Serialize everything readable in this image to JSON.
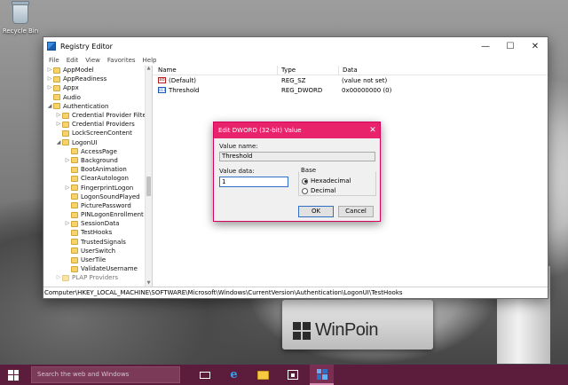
{
  "desktop": {
    "recycle_bin_label": "Recycle Bin",
    "brand_text": "WinPoin"
  },
  "window": {
    "title": "Registry Editor",
    "controls": {
      "minimize": "—",
      "maximize": "☐",
      "close": "✕"
    },
    "menu": [
      "File",
      "Edit",
      "View",
      "Favorites",
      "Help"
    ],
    "tree": [
      {
        "label": "AppModel",
        "level": 0,
        "expander": "▷"
      },
      {
        "label": "AppReadiness",
        "level": 0,
        "expander": "▷"
      },
      {
        "label": "Appx",
        "level": 0,
        "expander": "▷"
      },
      {
        "label": "Audio",
        "level": 0,
        "expander": ""
      },
      {
        "label": "Authentication",
        "level": 0,
        "expander": "◢"
      },
      {
        "label": "Credential Provider Filters",
        "level": 1,
        "expander": "▷"
      },
      {
        "label": "Credential Providers",
        "level": 1,
        "expander": "▷"
      },
      {
        "label": "LockScreenContent",
        "level": 1,
        "expander": ""
      },
      {
        "label": "LogonUI",
        "level": 1,
        "expander": "◢"
      },
      {
        "label": "AccessPage",
        "level": 2,
        "expander": ""
      },
      {
        "label": "Background",
        "level": 2,
        "expander": "▷"
      },
      {
        "label": "BootAnimation",
        "level": 2,
        "expander": ""
      },
      {
        "label": "ClearAutologon",
        "level": 2,
        "expander": ""
      },
      {
        "label": "FingerprintLogon",
        "level": 2,
        "expander": "▷"
      },
      {
        "label": "LogonSoundPlayed",
        "level": 2,
        "expander": ""
      },
      {
        "label": "PicturePassword",
        "level": 2,
        "expander": ""
      },
      {
        "label": "PINLogonEnrollment",
        "level": 2,
        "expander": ""
      },
      {
        "label": "SessionData",
        "level": 2,
        "expander": "▷"
      },
      {
        "label": "TestHooks",
        "level": 2,
        "expander": ""
      },
      {
        "label": "TrustedSignals",
        "level": 2,
        "expander": ""
      },
      {
        "label": "UserSwitch",
        "level": 2,
        "expander": ""
      },
      {
        "label": "UserTile",
        "level": 2,
        "expander": ""
      },
      {
        "label": "ValidateUsername",
        "level": 2,
        "expander": ""
      },
      {
        "label": "PLAP Providers",
        "level": 1,
        "expander": "▷",
        "partial": true
      }
    ],
    "columns": {
      "name": "Name",
      "type": "Type",
      "data": "Data"
    },
    "values": [
      {
        "name": "(Default)",
        "type": "REG_SZ",
        "data": "(value not set)",
        "icon": "string-value-icon"
      },
      {
        "name": "Threshold",
        "type": "REG_DWORD",
        "data": "0x00000000 (0)",
        "icon": "binary-value-icon"
      }
    ],
    "status_path": "Computer\\HKEY_LOCAL_MACHINE\\SOFTWARE\\Microsoft\\Windows\\CurrentVersion\\Authentication\\LogonUI\\TestHooks"
  },
  "dialog": {
    "title": "Edit DWORD (32-bit) Value",
    "close": "✕",
    "value_name_label": "Value name:",
    "value_name": "Threshold",
    "value_data_label": "Value data:",
    "value_data": "1",
    "base_label": "Base",
    "base_options": [
      "Hexadecimal",
      "Decimal"
    ],
    "base_selected": "Hexadecimal",
    "ok_label": "OK",
    "cancel_label": "Cancel",
    "accent_color": "#e8236b"
  },
  "taskbar": {
    "search_placeholder": "Search the web and Windows",
    "background_color": "#5b1d3b",
    "icons": [
      "task-view-icon",
      "edge-icon",
      "file-explorer-icon",
      "store-icon",
      "registry-editor-icon"
    ]
  }
}
